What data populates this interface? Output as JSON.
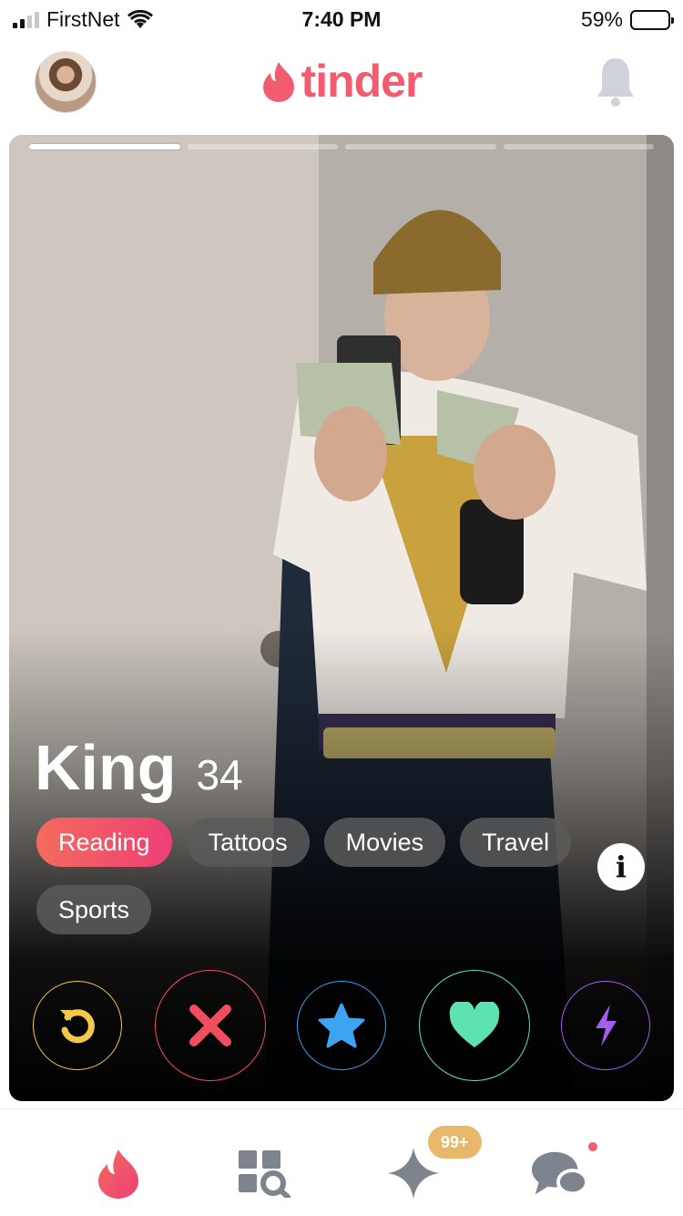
{
  "status": {
    "carrier": "FirstNet",
    "time": "7:40 PM",
    "battery": "59%",
    "battery_level": 0.59
  },
  "header": {
    "brand": "tinder"
  },
  "profile": {
    "name": "King",
    "age": "34",
    "interests": [
      "Reading",
      "Tattoos",
      "Movies",
      "Travel",
      "Sports"
    ],
    "info_label": "i",
    "photo_count": 4,
    "current_photo": 1
  },
  "actions": [
    "rewind",
    "nope",
    "super-like",
    "like",
    "boost"
  ],
  "tabs": {
    "badge": "99+"
  },
  "colors": {
    "brand": "#f25c6e",
    "rewind": "#f5c84c",
    "nope": "#f04e5f",
    "super": "#3ca4f2",
    "like": "#5ee2b0",
    "boost": "#a45cf2"
  }
}
